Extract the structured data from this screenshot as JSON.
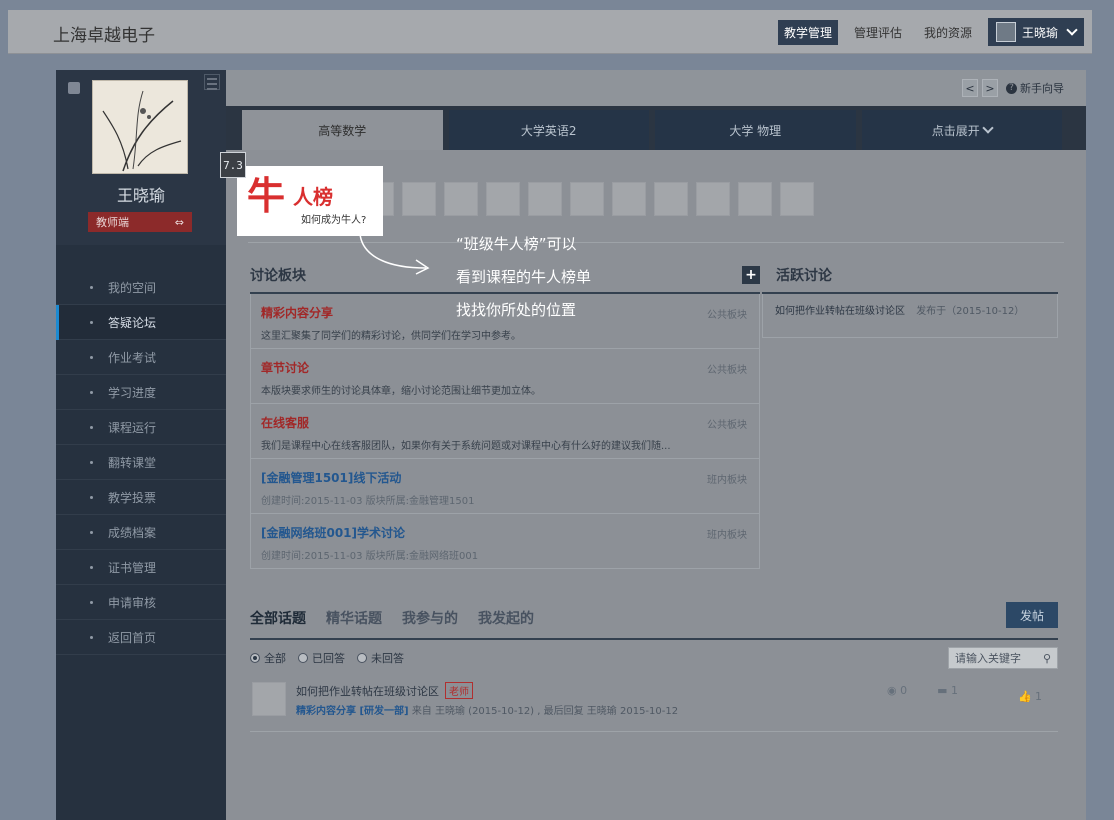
{
  "app": {
    "brand": "上海卓越电子"
  },
  "top_nav": {
    "items": [
      "教学管理",
      "管理评估",
      "我的资源"
    ],
    "user_name": "王晓瑜"
  },
  "sidebar": {
    "name": "王晓瑜",
    "role_label": "教师端",
    "items": [
      {
        "label": "我的空间"
      },
      {
        "label": "答疑论坛"
      },
      {
        "label": "作业考试"
      },
      {
        "label": "学习进度"
      },
      {
        "label": "课程运行"
      },
      {
        "label": "翻转课堂"
      },
      {
        "label": "教学投票"
      },
      {
        "label": "成绩档案"
      },
      {
        "label": "证书管理"
      },
      {
        "label": "申请审核"
      },
      {
        "label": "返回首页"
      }
    ]
  },
  "header": {
    "prev": "<",
    "next": ">",
    "help_label": "新手向导"
  },
  "course_tabs": [
    {
      "label": "高等数学"
    },
    {
      "label": "大学英语2"
    },
    {
      "label": "大学 物理"
    },
    {
      "label": "点击展开"
    }
  ],
  "star_board": {
    "big_char": "牛",
    "title": "人榜",
    "subtitle": "如何成为牛人?"
  },
  "guide": {
    "step": "7.3",
    "line1": "“班级牛人榜”可以",
    "line2": "看到课程的牛人榜单",
    "line3": "找找你所处的位置"
  },
  "forum": {
    "title": "讨论板块",
    "add": "+",
    "boards": [
      {
        "title": "精彩内容分享",
        "desc": "这里汇聚集了同学们的精彩讨论，供同学们在学习中参考。",
        "tag": "公共板块"
      },
      {
        "title": "章节讨论",
        "desc": "本版块要求师生的讨论具体章，缩小讨论范围让细节更加立体。",
        "tag": "公共板块"
      },
      {
        "title": "在线客服",
        "desc": "我们是课程中心在线客服团队，如果你有关于系统问题或对课程中心有什么好的建议我们随...",
        "tag": "公共板块"
      },
      {
        "title": "[金融管理1501]线下活动",
        "desc": "创建时间:2015-11-03   版块所属:金融管理1501",
        "tag": "班内板块"
      },
      {
        "title": "[金融网络班001]学术讨论",
        "desc": "创建时间:2015-11-03   版块所属:金融网络班001",
        "tag": "班内板块"
      }
    ]
  },
  "active_discussion": {
    "title": "活跃讨论",
    "item": "如何把作业转帖在班级讨论区",
    "date": "发布于（2015-10-12）"
  },
  "topics": {
    "tabs": [
      "全部话题",
      "精华话题",
      "我参与的",
      "我发起的"
    ],
    "post_label": "发帖",
    "filters": [
      "全部",
      "已回答",
      "未回答"
    ],
    "search_placeholder": "请输入关键字",
    "row": {
      "title": "如何把作业转帖在班级讨论区",
      "badge": "老师",
      "board": "精彩内容分享 [研发一部]",
      "meta": "来自 王晓瑜 (2015-10-12) , 最后回复 王晓瑜 2015-10-12",
      "views": "0",
      "replies": "1",
      "likes": "1"
    }
  }
}
